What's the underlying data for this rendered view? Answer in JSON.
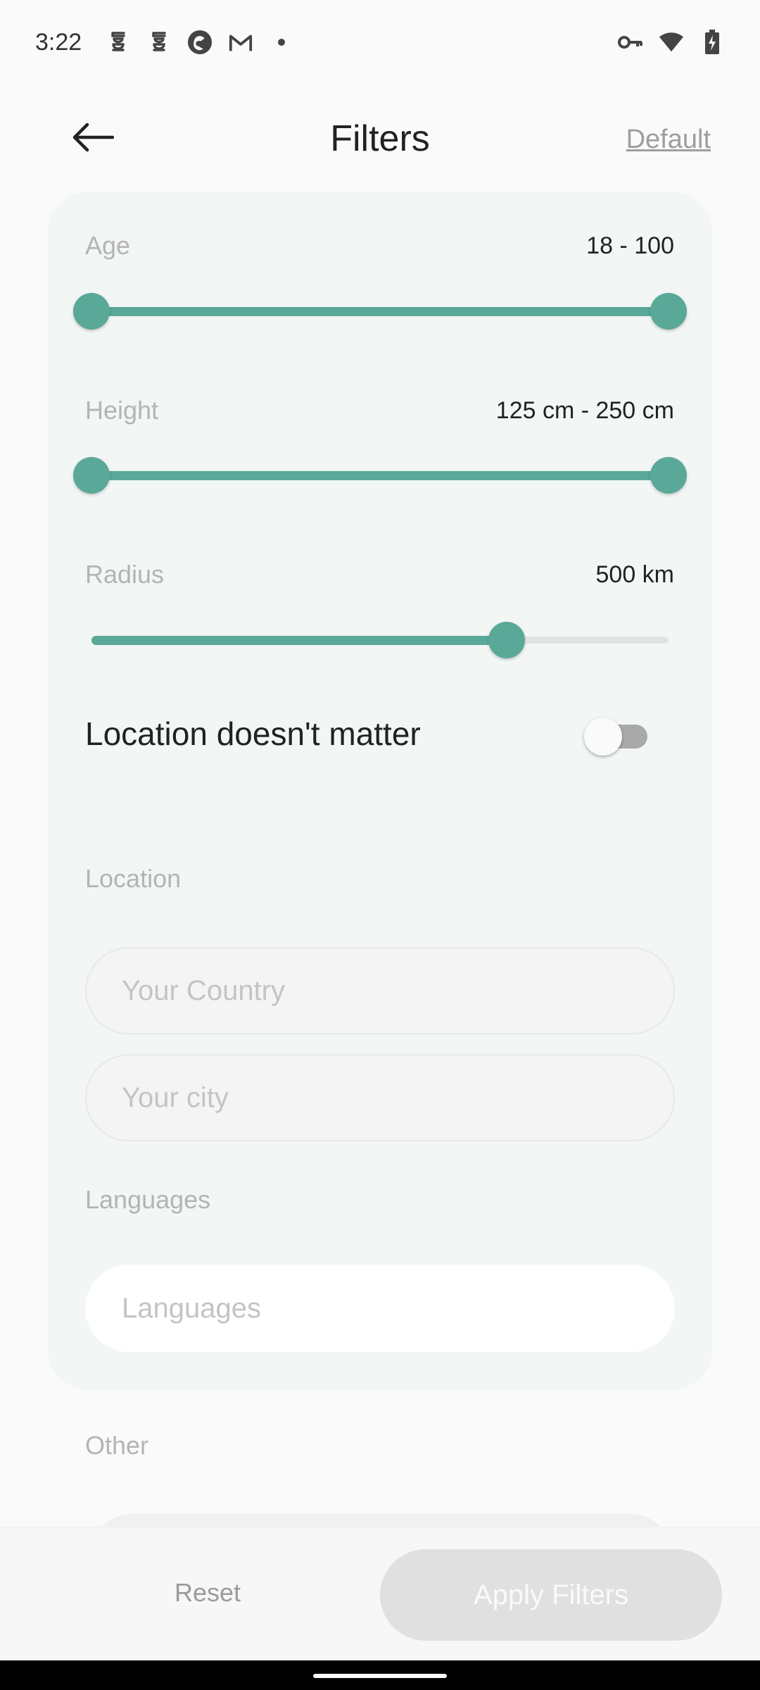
{
  "status_bar": {
    "time": "3:22",
    "left_icons": [
      "notification-icon",
      "notification-icon",
      "app-icon",
      "gmail-icon",
      "dot-icon"
    ],
    "right_icons": [
      "vpn-key-icon",
      "wifi-icon",
      "battery-charging-icon"
    ]
  },
  "header": {
    "title": "Filters",
    "default_label": "Default"
  },
  "filters": {
    "age": {
      "label": "Age",
      "value_text": "18 - 100",
      "min": 18,
      "max": 100,
      "low": 18,
      "high": 100
    },
    "height": {
      "label": "Height",
      "value_text": "125 cm - 250 cm",
      "min": 125,
      "max": 250,
      "low": 125,
      "high": 250
    },
    "radius": {
      "label": "Radius",
      "value_text": "500 km",
      "fraction": 0.72
    },
    "location_toggle": {
      "label": "Location doesn't matter",
      "on": false
    },
    "location": {
      "label": "Location",
      "country_placeholder": "Your Country",
      "city_placeholder": "Your city"
    },
    "languages": {
      "label": "Languages",
      "placeholder": "Languages"
    },
    "other": {
      "label": "Other"
    }
  },
  "actions": {
    "reset_label": "Reset",
    "apply_label": "Apply Filters"
  },
  "colors": {
    "accent": "#5aa898",
    "card_background": "#f2f6f5",
    "disabled_button": "#e0e0e0"
  }
}
